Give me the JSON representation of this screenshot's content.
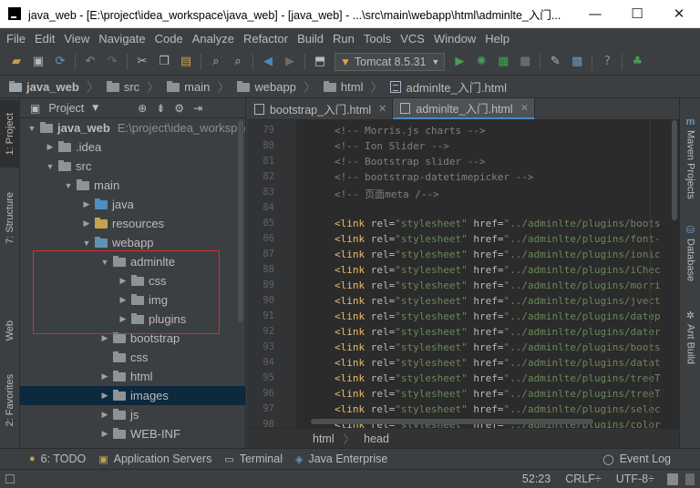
{
  "window": {
    "title": "java_web - [E:\\project\\idea_workspace\\java_web] - [java_web] - ...\\src\\main\\webapp\\html\\adminlte_入门...",
    "minimize": "—",
    "maximize": "☐",
    "close": "✕"
  },
  "menu": [
    "File",
    "Edit",
    "View",
    "Navigate",
    "Code",
    "Analyze",
    "Refactor",
    "Build",
    "Run",
    "Tools",
    "VCS",
    "Window",
    "Help"
  ],
  "toolbar": {
    "run_config": "Tomcat 8.5.31",
    "icons": [
      "open-icon",
      "save-icon",
      "sync-icon",
      "undo-icon",
      "redo-icon",
      "cut-icon",
      "copy-icon",
      "paste-icon",
      "find-icon",
      "replace-icon",
      "back-icon",
      "forward-icon",
      "build-icon",
      "run-icon",
      "debug-icon",
      "coverage-icon",
      "stop-icon",
      "settings-icon",
      "structure-icon",
      "help-icon",
      "android-icon"
    ]
  },
  "navbar": {
    "crumbs": [
      "java_web",
      "src",
      "main",
      "webapp",
      "html",
      "adminlte_入门.html"
    ]
  },
  "left_stripe": {
    "tabs": [
      "1: Project",
      "7: Structure",
      "Web",
      "2: Favorites"
    ]
  },
  "project_panel": {
    "title": "Project",
    "tree": [
      {
        "label": "java_web",
        "path": "E:\\project\\idea_workspace\\java_web",
        "depth": 0,
        "expanded": true,
        "kind": "project"
      },
      {
        "label": ".idea",
        "depth": 1,
        "expanded": false,
        "kind": "folder"
      },
      {
        "label": "src",
        "depth": 1,
        "expanded": true,
        "kind": "folder"
      },
      {
        "label": "main",
        "depth": 2,
        "expanded": true,
        "kind": "folder"
      },
      {
        "label": "java",
        "depth": 3,
        "expanded": false,
        "kind": "src"
      },
      {
        "label": "resources",
        "depth": 3,
        "expanded": false,
        "kind": "res"
      },
      {
        "label": "webapp",
        "depth": 3,
        "expanded": true,
        "kind": "web"
      },
      {
        "label": "adminlte",
        "depth": 4,
        "expanded": true,
        "kind": "folder"
      },
      {
        "label": "css",
        "depth": 5,
        "expanded": false,
        "kind": "folder"
      },
      {
        "label": "img",
        "depth": 5,
        "expanded": false,
        "kind": "folder"
      },
      {
        "label": "plugins",
        "depth": 5,
        "expanded": false,
        "kind": "folder"
      },
      {
        "label": "bootstrap",
        "depth": 4,
        "expanded": false,
        "kind": "folder"
      },
      {
        "label": "css",
        "depth": 4,
        "expanded": null,
        "kind": "folder"
      },
      {
        "label": "html",
        "depth": 4,
        "expanded": false,
        "kind": "folder"
      },
      {
        "label": "images",
        "depth": 4,
        "expanded": false,
        "kind": "folder",
        "selected": true
      },
      {
        "label": "js",
        "depth": 4,
        "expanded": false,
        "kind": "folder"
      },
      {
        "label": "WEB-INF",
        "depth": 4,
        "expanded": false,
        "kind": "folder"
      }
    ]
  },
  "editor": {
    "tabs": [
      {
        "label": "bootstrap_入门.html",
        "active": false
      },
      {
        "label": "adminlte_入门.html",
        "active": true
      }
    ],
    "line_numbers": [
      "79",
      "80",
      "81",
      "82",
      "83",
      "84",
      "85",
      "86",
      "87",
      "88",
      "89",
      "90",
      "91",
      "92",
      "93",
      "94",
      "95",
      "96",
      "97",
      "98"
    ],
    "lines": [
      {
        "type": "comment",
        "text": "<!-- Morris.js charts -->"
      },
      {
        "type": "comment",
        "text": "<!-- Ion Slider -->"
      },
      {
        "type": "comment",
        "text": "<!-- Bootstrap slider -->"
      },
      {
        "type": "comment",
        "text": "<!-- bootstrap-datetimepicker -->"
      },
      {
        "type": "comment",
        "text": "<!-- 页面meta /-->"
      },
      {
        "type": "blank",
        "text": ""
      },
      {
        "type": "link",
        "href": "\"../adminlte/plugins/boots"
      },
      {
        "type": "link",
        "href": "\"../adminlte/plugins/font-"
      },
      {
        "type": "link",
        "href": "\"../adminlte/plugins/ionic"
      },
      {
        "type": "link",
        "href": "\"../adminlte/plugins/iChec"
      },
      {
        "type": "link",
        "href": "\"../adminlte/plugins/morri"
      },
      {
        "type": "link",
        "href": "\"../adminlte/plugins/jvect"
      },
      {
        "type": "link",
        "href": "\"../adminlte/plugins/datep"
      },
      {
        "type": "link",
        "href": "\"../adminlte/plugins/dater"
      },
      {
        "type": "link",
        "href": "\"../adminlte/plugins/boots"
      },
      {
        "type": "link",
        "href": "\"../adminlte/plugins/datat"
      },
      {
        "type": "link",
        "href": "\"../adminlte/plugins/treeT"
      },
      {
        "type": "link",
        "href": "\"../adminlte/plugins/treeT"
      },
      {
        "type": "link",
        "href": "\"../adminlte/plugins/selec"
      },
      {
        "type": "link",
        "href": "\"../adminlte/plugins/color"
      }
    ],
    "link_parts": {
      "open": "<link",
      "rel_attr": " rel=",
      "rel_val": "\"stylesheet\"",
      "href_attr": " href="
    },
    "breadcrumb": [
      "html",
      "head"
    ]
  },
  "right_stripe": {
    "tabs": [
      "Maven Projects",
      "Database",
      "Ant Build"
    ]
  },
  "bottom_tabs": [
    {
      "label": "6: TODO",
      "icon": "todo-icon"
    },
    {
      "label": "Application Servers",
      "icon": "server-icon"
    },
    {
      "label": "Terminal",
      "icon": "terminal-icon"
    },
    {
      "label": "Java Enterprise",
      "icon": "java-enterprise-icon"
    }
  ],
  "event_log": "Event Log",
  "status": {
    "position": "52:23",
    "line_sep": "CRLF÷",
    "encoding": "UTF-8÷"
  }
}
